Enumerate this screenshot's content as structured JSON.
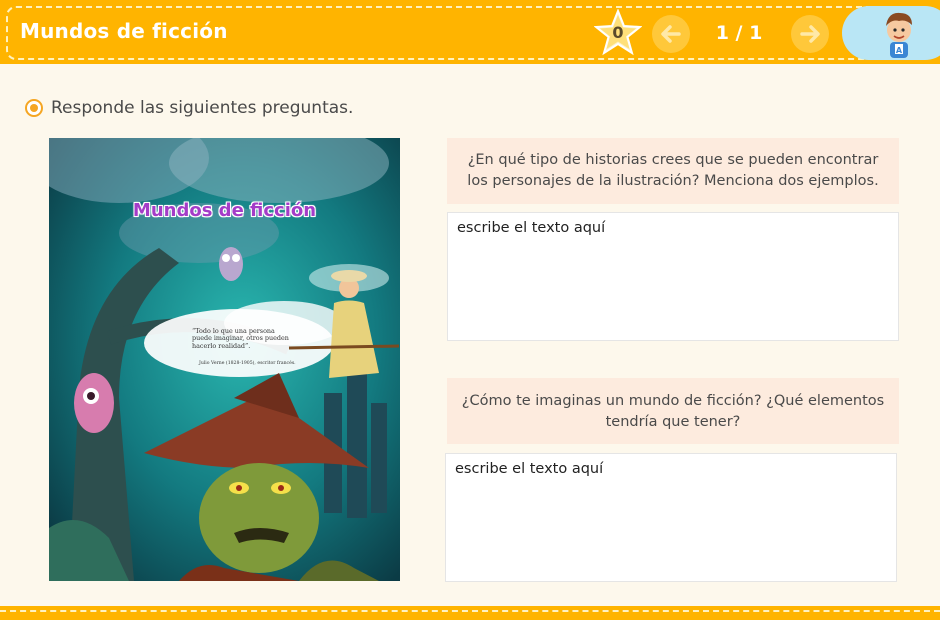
{
  "header": {
    "title": "Mundos de ficción",
    "star_count": "0",
    "page_indicator": "1 / 1"
  },
  "colors": {
    "header": "#ffb400",
    "background": "#fdf8ec",
    "question_bg": "#fdebde",
    "instruction_bullet": "#f5a623",
    "avatar_pill": "#b9e6f5"
  },
  "icons": {
    "star": "star-icon",
    "prev": "arrow-left-icon",
    "next": "arrow-right-icon",
    "avatar": "boy-avatar-icon",
    "instruction": "radio-bullet-icon"
  },
  "instruction": "Responde las siguientes preguntas.",
  "illustration": {
    "title": "Mundos de ficción",
    "quote": "“Todo lo que una persona puede imaginar, otros pueden hacerlo realidad”.",
    "quote_author": "Julio Verne (1828-1905), escritor francés."
  },
  "questions": [
    {
      "text": "¿En qué tipo de historias crees que se pueden encontrar los personajes de la ilustración? Menciona dos ejemplos.",
      "answer_placeholder": "escribe el texto aquí"
    },
    {
      "text": "¿Cómo te imaginas un mundo de ficción? ¿Qué elementos tendría que tener?",
      "answer_placeholder": "escribe el texto aquí"
    }
  ]
}
